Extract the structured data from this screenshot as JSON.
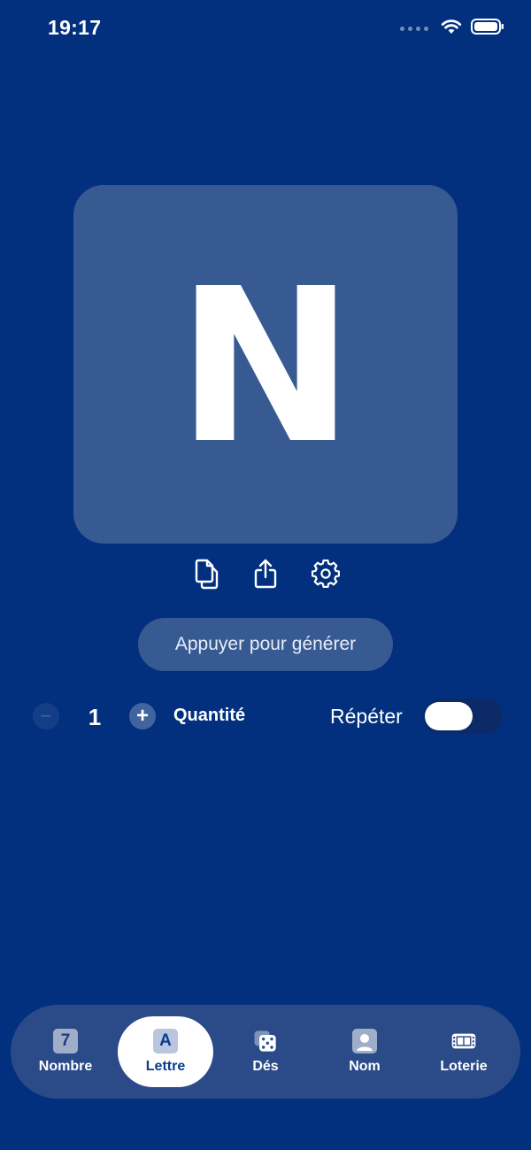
{
  "status_bar": {
    "time": "19:17"
  },
  "generator": {
    "result_letter": "N",
    "generate_label": "Appuyer pour générer"
  },
  "actions": {
    "icons": [
      "copy-icon",
      "share-icon",
      "gear-icon"
    ]
  },
  "quantity": {
    "minus_symbol": "−",
    "value": "1",
    "plus_symbol": "+",
    "label": "Quantité"
  },
  "repeat": {
    "label": "Répéter",
    "enabled": false
  },
  "tab_bar": {
    "selected": "Lettre",
    "tabs": [
      {
        "label": "Nombre",
        "glyph": "7",
        "icon": "number-square-icon"
      },
      {
        "label": "Lettre",
        "glyph": "A",
        "icon": "letter-square-icon"
      },
      {
        "label": "Dés",
        "icon": "dice-icon"
      },
      {
        "label": "Nom",
        "icon": "person-icon"
      },
      {
        "label": "Loterie",
        "icon": "ticket-icon"
      }
    ]
  },
  "colors": {
    "background": "#02307e",
    "card": "#385a93",
    "tab_bar": "#2a4a88",
    "active_tab": "#ffffff",
    "active_tab_text": "#0b3c8c"
  }
}
